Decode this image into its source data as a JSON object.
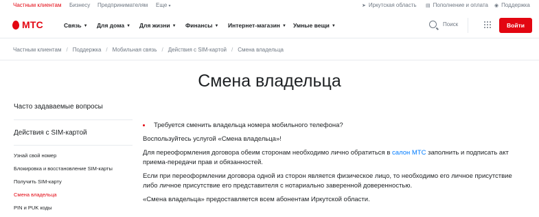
{
  "topbar": {
    "segments": [
      "Частным клиентам",
      "Бизнесу",
      "Предпринимателям",
      "Еще"
    ],
    "more_caret": "▾",
    "region": "Иркутская область",
    "payments": "Пополнение и оплата",
    "support": "Поддержка"
  },
  "brand": {
    "name": "МТС",
    "color": "#e30611"
  },
  "nav": {
    "items": [
      "Связь",
      "Для дома",
      "Для жизни",
      "Финансы",
      "Интернет-магазин",
      "Умные вещи"
    ],
    "search_label": "Поиск",
    "login_label": "Войти"
  },
  "breadcrumb": [
    "Частным клиентам",
    "Поддержка",
    "Мобильная связь",
    "Действия с SIM-картой",
    "Смена владельца"
  ],
  "page_title": "Смена владельца",
  "sidebar": {
    "faq": "Часто задаваемые вопросы",
    "heading": "Действия с SIM-картой",
    "items": [
      {
        "label": "Узнай свой номер",
        "active": false
      },
      {
        "label": "Блокировка и восстановление SIM-карты",
        "active": false
      },
      {
        "label": "Получить SIM-карту",
        "active": false
      },
      {
        "label": "Смена владельца",
        "active": true
      },
      {
        "label": "PIN и PUK коды",
        "active": false
      }
    ]
  },
  "content": {
    "question": "Требуется сменить владельца номера мобильного телефона?",
    "p1": "Воспользуйтесь услугой «Смена владельца»!",
    "p2_before": "Для переоформления договора обеим сторонам необходимо лично обратиться в ",
    "p2_link": "салон МТС",
    "p2_after": " заполнить и подписать акт приема-передачи прав и обязанностей.",
    "p3": "Если при переоформлении договора одной из сторон является физическое лицо, то необходимо его личное присутствие либо личное присутствие его представителя с нотариально заверенной доверенностью.",
    "p4": "«Смена владельца» предоставляется всем абонентам Иркутской области."
  },
  "colors": {
    "accent": "#e30611",
    "link": "#007cff",
    "muted": "#6e7782"
  }
}
